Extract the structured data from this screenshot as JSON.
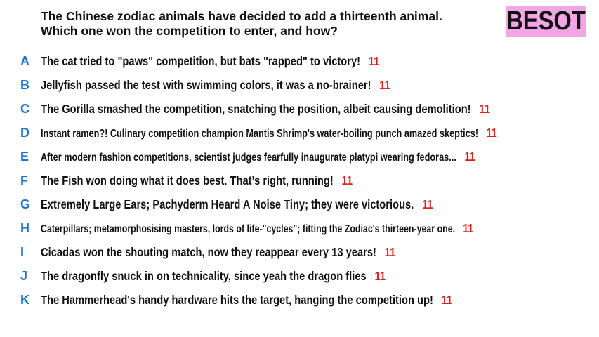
{
  "question": {
    "line1": "The Chinese zodiac animals have decided to add a thirteenth animal.",
    "line2": "Which one won the competition to enter, and how?"
  },
  "badge": {
    "label": "BESOT",
    "color": "#f3a6e6"
  },
  "colors": {
    "letter": "#1a75d2",
    "score": "#e41b1b",
    "text": "#111111"
  },
  "answers": [
    {
      "letter": "A",
      "text": "The cat tried to \"paws\" competition, but bats \"rapped\" to victory!",
      "score": "11"
    },
    {
      "letter": "B",
      "text": "Jellyfish passed the test with swimming colors, it was a no-brainer!",
      "score": "11"
    },
    {
      "letter": "C",
      "text": "The Gorilla smashed the competition, snatching the position, albeit causing demolition!",
      "score": "11"
    },
    {
      "letter": "D",
      "text": "Instant ramen?! Culinary competition champion Mantis Shrimp's water-boiling punch amazed skeptics!",
      "score": "11"
    },
    {
      "letter": "E",
      "text": "After modern fashion competitions, scientist judges fearfully inaugurate platypi wearing fedoras...",
      "score": "11"
    },
    {
      "letter": "F",
      "text": "The Fish won doing what it does best. That’s right, running!",
      "score": "11"
    },
    {
      "letter": "G",
      "text": "Extremely Large Ears; Pachyderm Heard A Noise Tiny; they were victorious.",
      "score": "11"
    },
    {
      "letter": "H",
      "text": "Caterpillars; metamorphosising masters, lords of life-\"cycles\"; fitting the Zodiac's thirteen-year one.",
      "score": "11"
    },
    {
      "letter": "I",
      "text": "Cicadas won the shouting match, now they reappear every 13 years!",
      "score": "11"
    },
    {
      "letter": "J",
      "text": "The dragonfly snuck in on technicality, since yeah the dragon flies",
      "score": "11"
    },
    {
      "letter": "K",
      "text": "The Hammerhead's handy hardware hits the target, hanging the competition up!",
      "score": "11"
    }
  ]
}
